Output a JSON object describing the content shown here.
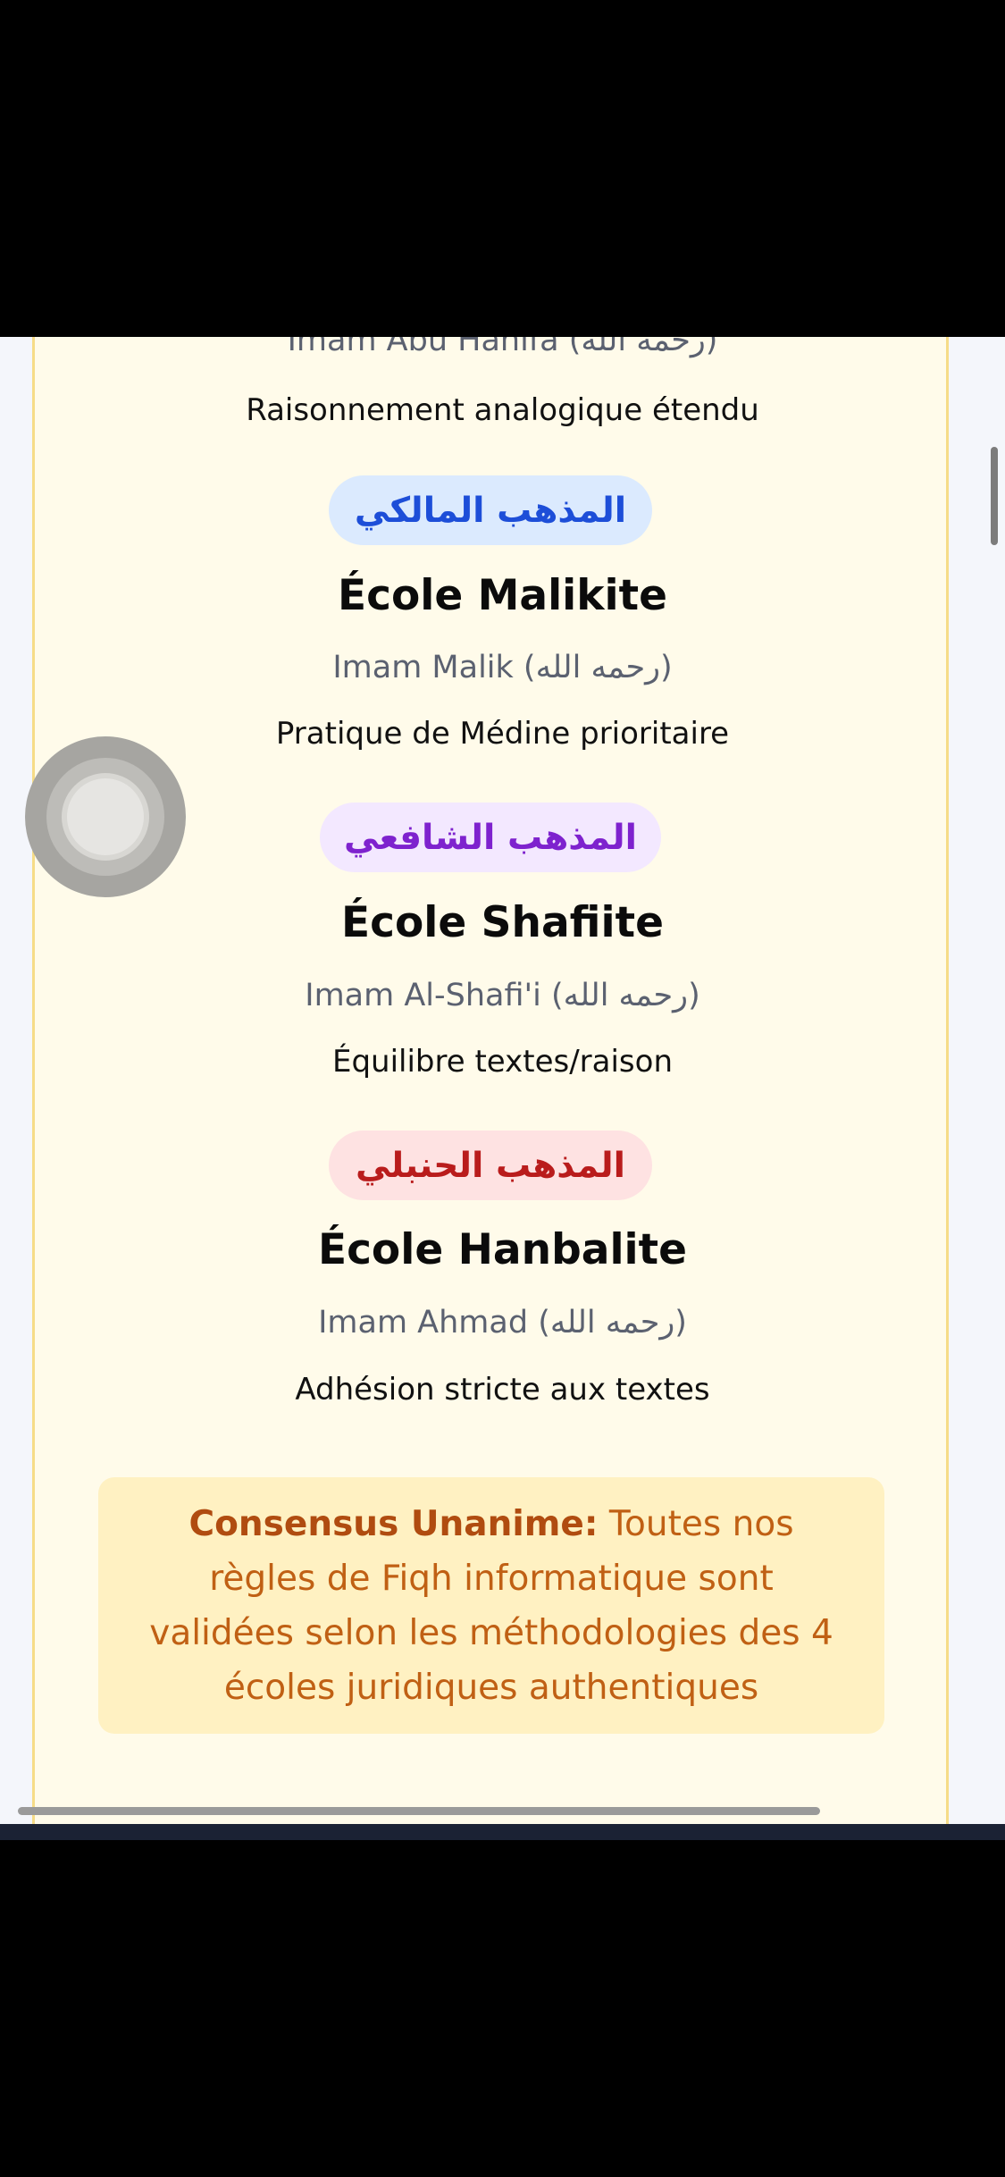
{
  "top_cut": {
    "imam": "Imam Abu Hanifa (رحمه الله)",
    "desc": "Raisonnement analogique étendu"
  },
  "schools": [
    {
      "arabic": "المذهب المالكي",
      "title": "École Malikite",
      "imam": "Imam Malik (رحمه الله)",
      "desc": "Pratique de Médine prioritaire",
      "pill_bg": "#dbeafe",
      "pill_color": "#1d4ed8"
    },
    {
      "arabic": "المذهب الشافعي",
      "title": "École Shafiite",
      "imam": "Imam Al-Shafi'i (رحمه الله)",
      "desc": "Équilibre textes/raison",
      "pill_bg": "#f3e8ff",
      "pill_color": "#7e22ce"
    },
    {
      "arabic": "المذهب الحنبلي",
      "title": "École Hanbalite",
      "imam": "Imam Ahmad (رحمه الله)",
      "desc": "Adhésion stricte aux textes",
      "pill_bg": "#fee2e2",
      "pill_color": "#b91c1c"
    }
  ],
  "consensus": {
    "label": "Consensus Unanime:",
    "text": " Toutes nos règles de Fiqh informatique sont validées selon les méthodologies des 4 écoles juridiques authentiques"
  },
  "colors": {
    "card_bg": "#fffbea",
    "card_border": "#f6dc87",
    "consensus_bg": "#fff1c2",
    "consensus_text": "#c06014"
  }
}
